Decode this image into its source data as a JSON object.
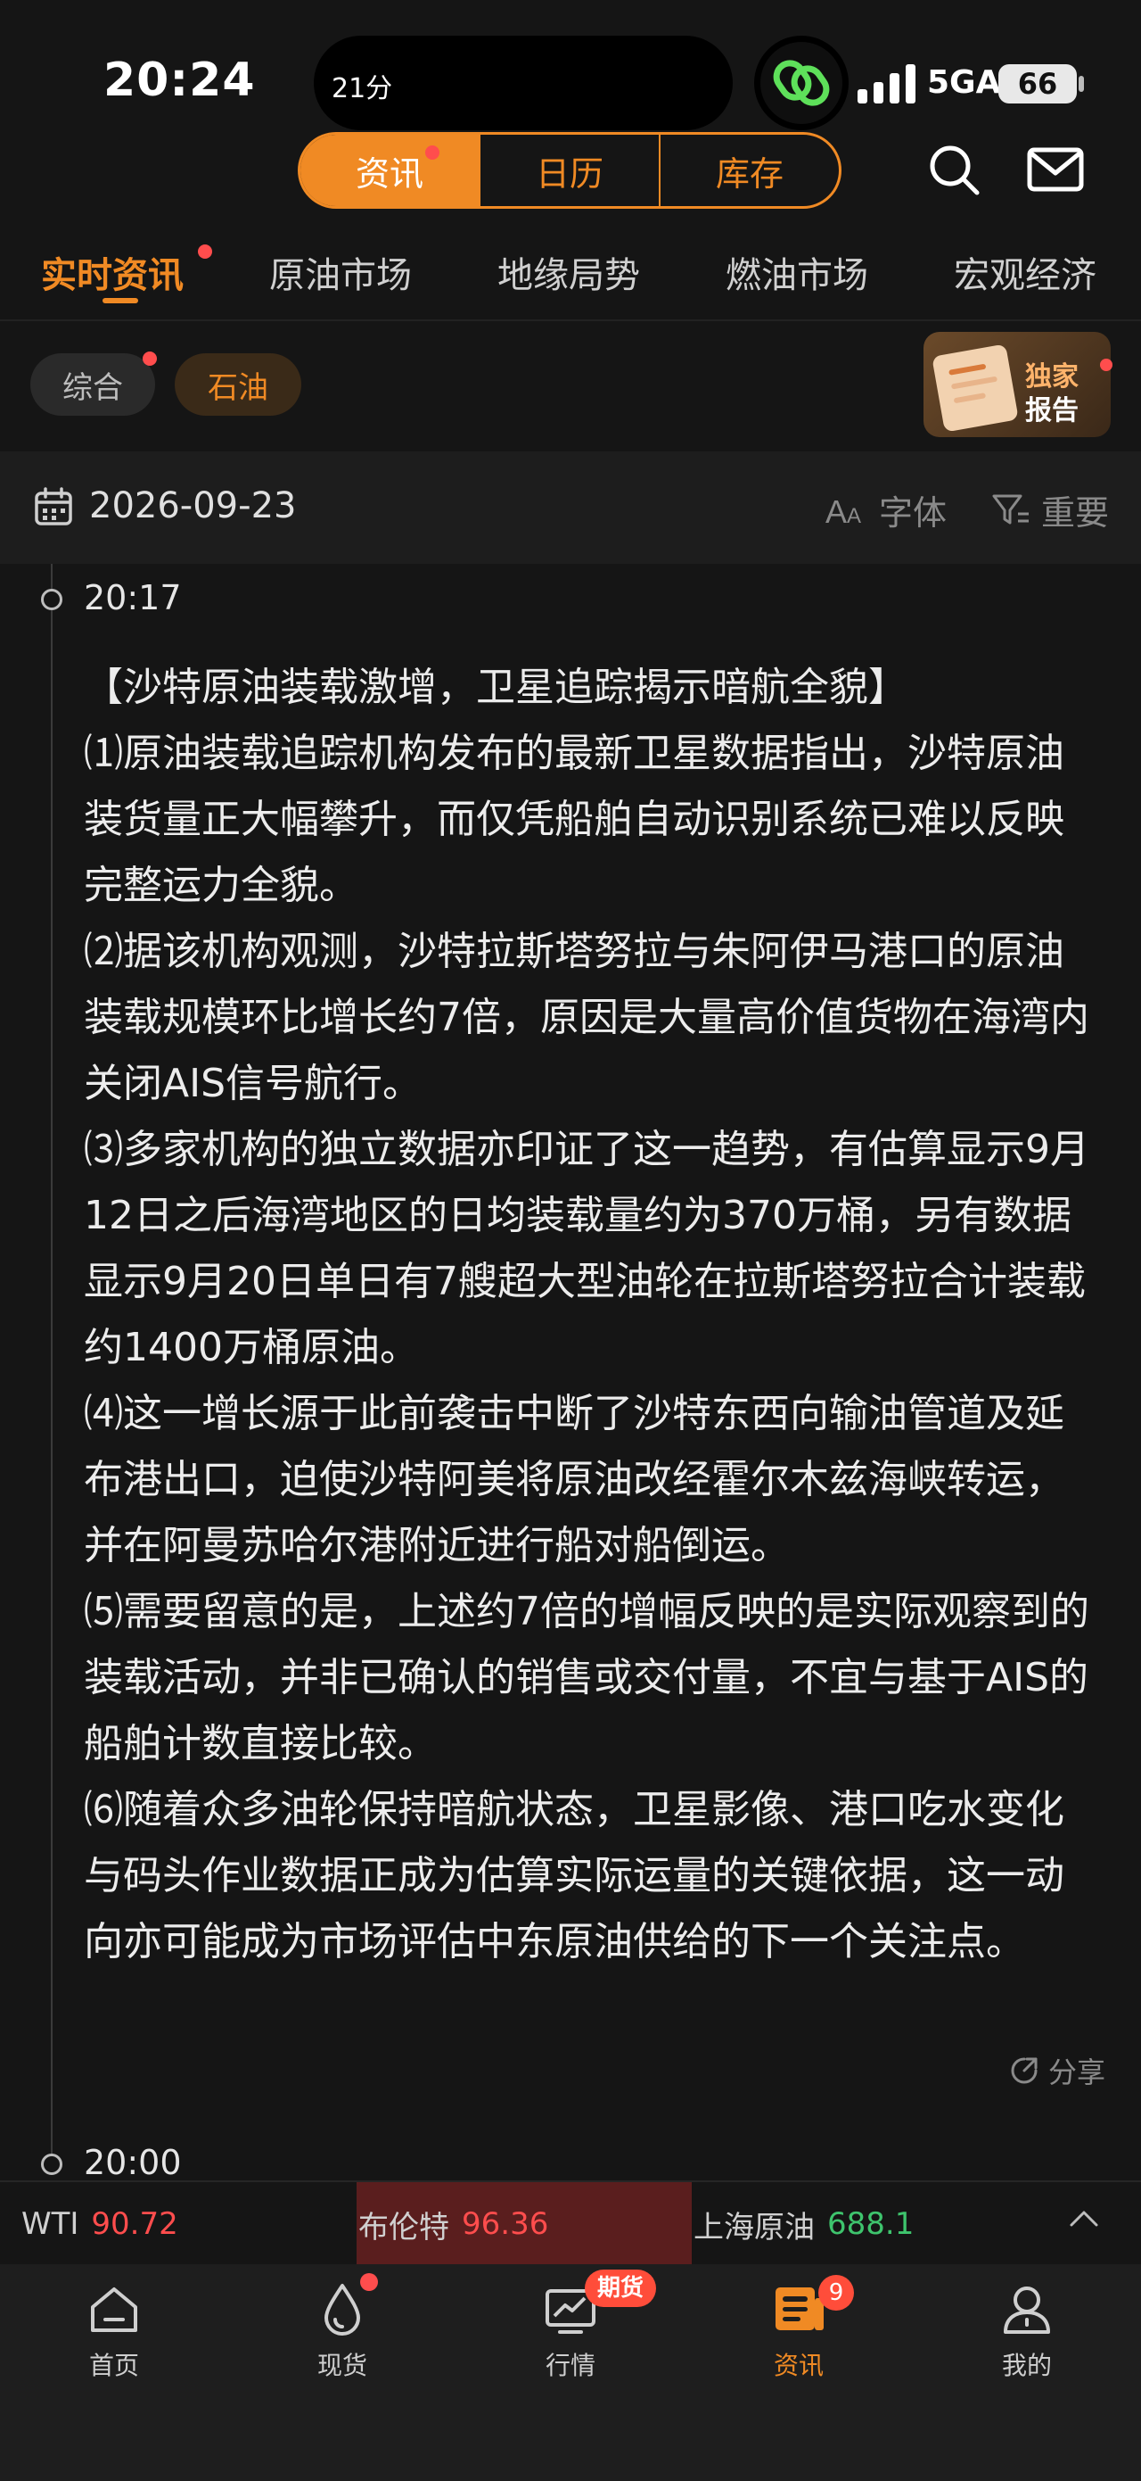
{
  "status_bar": {
    "time": "20:24",
    "island_text": "21分",
    "network": "5GA",
    "battery": "66"
  },
  "header": {
    "segments": [
      {
        "label": "资讯",
        "active": true
      },
      {
        "label": "日历",
        "active": false
      },
      {
        "label": "库存",
        "active": false
      }
    ],
    "search_icon": "search-icon",
    "mail_icon": "mail-icon"
  },
  "category_tabs": [
    "实时资讯",
    "原油市场",
    "地缘局势",
    "燃油市场",
    "宏观经济"
  ],
  "filter_chips": [
    "综合",
    "石油"
  ],
  "report_badge": {
    "line1": "独家",
    "line2": "报告"
  },
  "date_bar": {
    "date": "2026-09-23",
    "font_label": "字体",
    "important_label": "重要"
  },
  "feed": [
    {
      "time": "20:17",
      "paragraphs": [
        "【沙特原油装载激增，卫星追踪揭示暗航全貌】",
        "⑴原油装载追踪机构发布的最新卫星数据指出，沙特原油装货量正大幅攀升，而仅凭船舶自动识别系统已难以反映完整运力全貌。",
        "⑵据该机构观测，沙特拉斯塔努拉与朱阿伊马港口的原油装载规模环比增长约7倍，原因是大量高价值货物在海湾内关闭AIS信号航行。",
        "⑶多家机构的独立数据亦印证了这一趋势，有估算显示9月12日之后海湾地区的日均装载量约为370万桶，另有数据显示9月20日单日有7艘超大型油轮在拉斯塔努拉合计装载约1400万桶原油。",
        "⑷这一增长源于此前袭击中断了沙特东西向输油管道及延布港出口，迫使沙特阿美将原油改经霍尔木兹海峡转运，并在阿曼苏哈尔港附近进行船对船倒运。",
        "⑸需要留意的是，上述约7倍的增幅反映的是实际观察到的装载活动，并非已确认的销售或交付量，不宜与基于AIS的船舶计数直接比较。",
        "⑹随着众多油轮保持暗航状态，卫星影像、港口吃水变化与码头作业数据正成为估算实际运量的关键依据，这一动向亦可能成为市场评估中东原油供给的下一个关注点。"
      ],
      "share_label": "分享"
    },
    {
      "time": "20:00"
    }
  ],
  "ticker": [
    {
      "name": "WTI",
      "value": "90.72",
      "color": "#ff4d4d"
    },
    {
      "name": "布伦特",
      "value": "96.36",
      "color": "#ff4d4d"
    },
    {
      "name": "上海原油",
      "value": "688.1",
      "color": "#3ec46d"
    }
  ],
  "bottom_nav": {
    "items": [
      {
        "label": "首页",
        "icon": "home-icon"
      },
      {
        "label": "现货",
        "icon": "drop-icon"
      },
      {
        "label": "行情",
        "icon": "chart-icon"
      },
      {
        "label": "资讯",
        "icon": "news-icon",
        "active": true
      },
      {
        "label": "我的",
        "icon": "profile-icon"
      }
    ],
    "futures_badge": "期货",
    "news_count": "9"
  },
  "colors": {
    "accent": "#f08a24",
    "background": "#151515",
    "alert": "#ff4d4d",
    "up_green": "#3ec46d"
  }
}
